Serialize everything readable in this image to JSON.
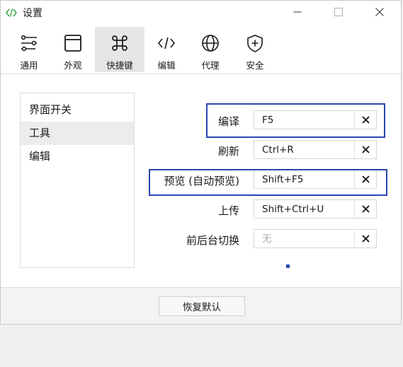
{
  "window": {
    "title": "设置",
    "accent_color": "#2b47b3",
    "app_icon": "code-icon"
  },
  "toolbar": {
    "tabs": [
      {
        "label": "通用",
        "icon": "sliders-icon"
      },
      {
        "label": "外观",
        "icon": "window-icon"
      },
      {
        "label": "快捷键",
        "icon": "command-key-icon",
        "active": true
      },
      {
        "label": "编辑",
        "icon": "code-icon"
      },
      {
        "label": "代理",
        "icon": "globe-icon"
      },
      {
        "label": "安全",
        "icon": "shield-plus-icon"
      }
    ]
  },
  "sidebar": {
    "items": [
      {
        "label": "界面开关"
      },
      {
        "label": "工具",
        "selected": true
      },
      {
        "label": "编辑"
      }
    ]
  },
  "shortcuts": [
    {
      "label": "编译",
      "value": "F5",
      "placeholder": ""
    },
    {
      "label": "刷新",
      "value": "Ctrl+R",
      "placeholder": ""
    },
    {
      "label": "预览 (自动预览)",
      "value": "Shift+F5",
      "placeholder": ""
    },
    {
      "label": "上传",
      "value": "Shift+Ctrl+U",
      "placeholder": ""
    },
    {
      "label": "前后台切换",
      "value": "",
      "placeholder": "无"
    }
  ],
  "footer": {
    "restore_label": "恢复默认"
  }
}
